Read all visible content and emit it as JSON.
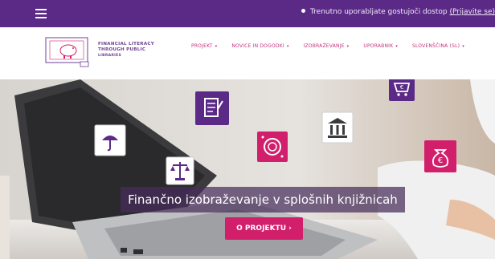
{
  "topbar": {
    "notice": "Trenutno uporabljate gostujoči dostop",
    "login_link": "(Prijavite se)"
  },
  "brand": {
    "line1": "FINANCIAL LITERACY",
    "line2": "THROUGH PUBLIC",
    "line3": "LIBRARIES"
  },
  "nav": [
    {
      "label": "PROJEKT",
      "caret": "▾"
    },
    {
      "label": "NOVICE IN DOGODKI",
      "caret": "▾"
    },
    {
      "label": "IZOBRAŽEVANJE",
      "caret": "▾"
    },
    {
      "label": "UPORABNIK",
      "caret": "▾"
    },
    {
      "label": "SLOVENŠČINA (SL)",
      "caret": "▾"
    }
  ],
  "hero": {
    "caption": "Finančno izobraževanje v splošnih knjižnicah",
    "cta": "O PROJEKTU ›"
  },
  "colors": {
    "purple": "#5a2a86",
    "magenta": "#d21f6b",
    "caption_bg": "#462d5a"
  },
  "icons": [
    "menu-icon",
    "piggy-bank-icon",
    "umbrella-icon",
    "scales-icon",
    "certificate-icon",
    "coins-icon",
    "bank-icon",
    "euro-cart-icon",
    "euro-moneybag-icon"
  ]
}
